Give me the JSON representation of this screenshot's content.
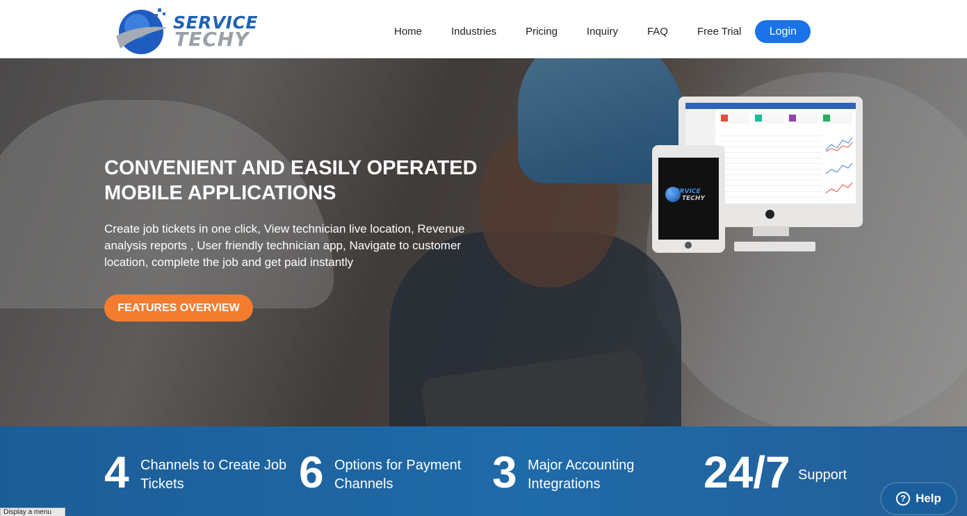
{
  "brand": {
    "word1": "SERVICE",
    "word2": "TECHY",
    "logo_icon": "globe-swoosh-icon"
  },
  "nav": {
    "items": [
      "Home",
      "Industries",
      "Pricing",
      "Inquiry",
      "FAQ",
      "Free Trial"
    ],
    "login": "Login"
  },
  "hero": {
    "title": "CONVENIENT AND EASILY OPERATED MOBILE APPLICATIONS",
    "text": "Create job tickets in one click, View technician live location, Revenue analysis reports , User friendly technician app, Navigate to customer location, complete the job and get paid instantly",
    "cta": "FEATURES OVERVIEW"
  },
  "devices": {
    "pad_word1": "SERVICE",
    "pad_word2": "TECHY"
  },
  "stats": [
    {
      "num": "4",
      "label": "Channels to Create Job Tickets"
    },
    {
      "num": "6",
      "label": "Options for Payment Channels"
    },
    {
      "num": "3",
      "label": "Major Accounting Integrations"
    },
    {
      "num": "24/7",
      "label": "Support"
    }
  ],
  "help": {
    "label": "Help",
    "icon": "question-circle-icon"
  },
  "tooltip": "Display a menu",
  "colors": {
    "primary": "#1a73e8",
    "accent": "#f37c2f",
    "band": "#1d5f9b"
  }
}
